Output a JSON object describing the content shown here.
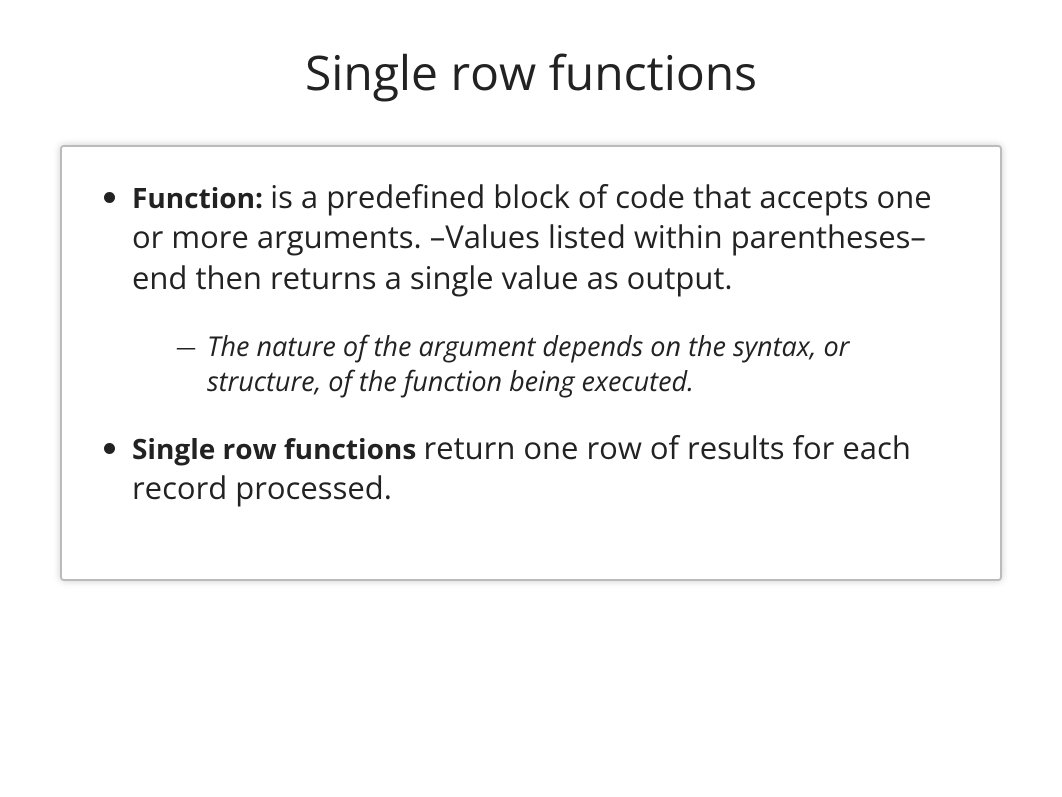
{
  "title": "Single row functions",
  "bullets": [
    {
      "label": "Function: ",
      "text": "is a predefined block of code that accepts one or more arguments. –Values listed within parentheses– end then returns a single value as output.",
      "sub": "The nature of the argument depends on the syntax, or structure, of the function being executed."
    },
    {
      "label": "Single row functions ",
      "text": "return one row of results for each record processed."
    }
  ]
}
